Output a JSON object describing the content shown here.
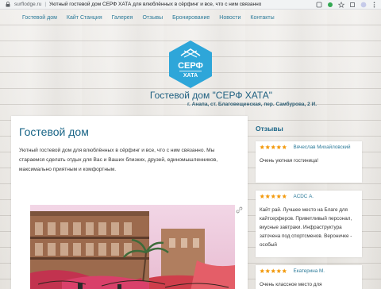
{
  "browser": {
    "url": "surflodge.ru",
    "separator": "|",
    "page_title": "Уютный гостевой дом СЕРФ ХАТА для влюблённых в сёрфинг и все, что с ним связанно"
  },
  "nav": {
    "items": [
      "Гостевой дом",
      "Кайт Станция",
      "Галерея",
      "Отзывы",
      "Бронирование",
      "Новости",
      "Контакты"
    ]
  },
  "logo": {
    "line1": "СЕРФ",
    "line2": "ХАТА",
    "color": "#2ea6d9"
  },
  "header": {
    "title": "Гостевой дом \"СЕРФ ХАТА\"",
    "address": "г. Анапа, ст. Благовещенская, пер. Самбурова, 2 И."
  },
  "main": {
    "heading": "Гостевой дом",
    "intro": "Уютный гостевой дом для влюблённых в сёрфинг и все, что с ним связанно. Мы стараемся сделать отдых для Вас и Ваших близких, друзей, единомышленников, максимально приятным и комфортным."
  },
  "sidebar": {
    "heading": "Отзывы",
    "reviews": [
      {
        "rating": 5,
        "name": "Вячеслав Михайловский",
        "text": "Очень уютная гостиница!"
      },
      {
        "rating": 5,
        "name": "ACDC А.",
        "text": "Кайт рай. Лучшее место на Благе для кайтсерферов. Приветливый персонал, вкусные завтраки. Инфраструктура заточена под спортсменов. Вероничке - особый"
      },
      {
        "rating": 5,
        "name": "Екатерина М.",
        "text": "Очень классное место для"
      }
    ]
  },
  "colors": {
    "accent": "#1a6587",
    "link": "#2b7a99",
    "star": "#f39c12"
  }
}
